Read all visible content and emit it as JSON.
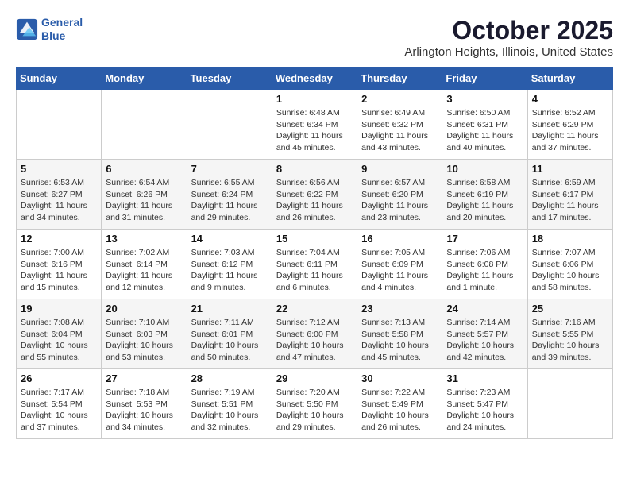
{
  "logo": {
    "line1": "General",
    "line2": "Blue"
  },
  "title": "October 2025",
  "location": "Arlington Heights, Illinois, United States",
  "weekdays": [
    "Sunday",
    "Monday",
    "Tuesday",
    "Wednesday",
    "Thursday",
    "Friday",
    "Saturday"
  ],
  "weeks": [
    [
      {
        "day": "",
        "info": ""
      },
      {
        "day": "",
        "info": ""
      },
      {
        "day": "",
        "info": ""
      },
      {
        "day": "1",
        "info": "Sunrise: 6:48 AM\nSunset: 6:34 PM\nDaylight: 11 hours\nand 45 minutes."
      },
      {
        "day": "2",
        "info": "Sunrise: 6:49 AM\nSunset: 6:32 PM\nDaylight: 11 hours\nand 43 minutes."
      },
      {
        "day": "3",
        "info": "Sunrise: 6:50 AM\nSunset: 6:31 PM\nDaylight: 11 hours\nand 40 minutes."
      },
      {
        "day": "4",
        "info": "Sunrise: 6:52 AM\nSunset: 6:29 PM\nDaylight: 11 hours\nand 37 minutes."
      }
    ],
    [
      {
        "day": "5",
        "info": "Sunrise: 6:53 AM\nSunset: 6:27 PM\nDaylight: 11 hours\nand 34 minutes."
      },
      {
        "day": "6",
        "info": "Sunrise: 6:54 AM\nSunset: 6:26 PM\nDaylight: 11 hours\nand 31 minutes."
      },
      {
        "day": "7",
        "info": "Sunrise: 6:55 AM\nSunset: 6:24 PM\nDaylight: 11 hours\nand 29 minutes."
      },
      {
        "day": "8",
        "info": "Sunrise: 6:56 AM\nSunset: 6:22 PM\nDaylight: 11 hours\nand 26 minutes."
      },
      {
        "day": "9",
        "info": "Sunrise: 6:57 AM\nSunset: 6:20 PM\nDaylight: 11 hours\nand 23 minutes."
      },
      {
        "day": "10",
        "info": "Sunrise: 6:58 AM\nSunset: 6:19 PM\nDaylight: 11 hours\nand 20 minutes."
      },
      {
        "day": "11",
        "info": "Sunrise: 6:59 AM\nSunset: 6:17 PM\nDaylight: 11 hours\nand 17 minutes."
      }
    ],
    [
      {
        "day": "12",
        "info": "Sunrise: 7:00 AM\nSunset: 6:16 PM\nDaylight: 11 hours\nand 15 minutes."
      },
      {
        "day": "13",
        "info": "Sunrise: 7:02 AM\nSunset: 6:14 PM\nDaylight: 11 hours\nand 12 minutes."
      },
      {
        "day": "14",
        "info": "Sunrise: 7:03 AM\nSunset: 6:12 PM\nDaylight: 11 hours\nand 9 minutes."
      },
      {
        "day": "15",
        "info": "Sunrise: 7:04 AM\nSunset: 6:11 PM\nDaylight: 11 hours\nand 6 minutes."
      },
      {
        "day": "16",
        "info": "Sunrise: 7:05 AM\nSunset: 6:09 PM\nDaylight: 11 hours\nand 4 minutes."
      },
      {
        "day": "17",
        "info": "Sunrise: 7:06 AM\nSunset: 6:08 PM\nDaylight: 11 hours\nand 1 minute."
      },
      {
        "day": "18",
        "info": "Sunrise: 7:07 AM\nSunset: 6:06 PM\nDaylight: 10 hours\nand 58 minutes."
      }
    ],
    [
      {
        "day": "19",
        "info": "Sunrise: 7:08 AM\nSunset: 6:04 PM\nDaylight: 10 hours\nand 55 minutes."
      },
      {
        "day": "20",
        "info": "Sunrise: 7:10 AM\nSunset: 6:03 PM\nDaylight: 10 hours\nand 53 minutes."
      },
      {
        "day": "21",
        "info": "Sunrise: 7:11 AM\nSunset: 6:01 PM\nDaylight: 10 hours\nand 50 minutes."
      },
      {
        "day": "22",
        "info": "Sunrise: 7:12 AM\nSunset: 6:00 PM\nDaylight: 10 hours\nand 47 minutes."
      },
      {
        "day": "23",
        "info": "Sunrise: 7:13 AM\nSunset: 5:58 PM\nDaylight: 10 hours\nand 45 minutes."
      },
      {
        "day": "24",
        "info": "Sunrise: 7:14 AM\nSunset: 5:57 PM\nDaylight: 10 hours\nand 42 minutes."
      },
      {
        "day": "25",
        "info": "Sunrise: 7:16 AM\nSunset: 5:55 PM\nDaylight: 10 hours\nand 39 minutes."
      }
    ],
    [
      {
        "day": "26",
        "info": "Sunrise: 7:17 AM\nSunset: 5:54 PM\nDaylight: 10 hours\nand 37 minutes."
      },
      {
        "day": "27",
        "info": "Sunrise: 7:18 AM\nSunset: 5:53 PM\nDaylight: 10 hours\nand 34 minutes."
      },
      {
        "day": "28",
        "info": "Sunrise: 7:19 AM\nSunset: 5:51 PM\nDaylight: 10 hours\nand 32 minutes."
      },
      {
        "day": "29",
        "info": "Sunrise: 7:20 AM\nSunset: 5:50 PM\nDaylight: 10 hours\nand 29 minutes."
      },
      {
        "day": "30",
        "info": "Sunrise: 7:22 AM\nSunset: 5:49 PM\nDaylight: 10 hours\nand 26 minutes."
      },
      {
        "day": "31",
        "info": "Sunrise: 7:23 AM\nSunset: 5:47 PM\nDaylight: 10 hours\nand 24 minutes."
      },
      {
        "day": "",
        "info": ""
      }
    ]
  ]
}
